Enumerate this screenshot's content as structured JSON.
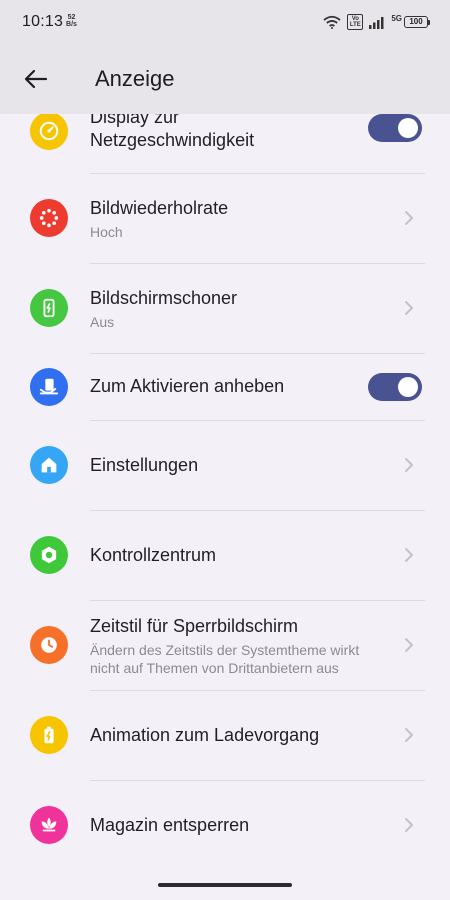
{
  "status_bar": {
    "time": "10:13",
    "net_speed_value": "52",
    "net_speed_unit": "B/s",
    "volte_top": "Vo",
    "volte_bottom": "LTE",
    "network": "5G",
    "battery": "100"
  },
  "header": {
    "title": "Anzeige"
  },
  "settings": [
    {
      "title_line1": "Display zur",
      "title_line2": "Netzgeschwindigkeit",
      "toggle": "on",
      "icon": "speedometer-icon",
      "color": "#f7c400"
    },
    {
      "title": "Bildwiederholrate",
      "subtitle": "Hoch",
      "icon": "refresh-rate-icon",
      "color": "#ee3b2f"
    },
    {
      "title": "Bildschirmschoner",
      "subtitle": "Aus",
      "icon": "screensaver-icon",
      "color": "#45c742"
    },
    {
      "title": "Zum Aktivieren anheben",
      "toggle": "on",
      "icon": "raise-hand-phone-icon",
      "color": "#2f6ff0"
    },
    {
      "title": "Einstellungen",
      "icon": "home-icon",
      "color": "#35a6f5"
    },
    {
      "title": "Kontrollzentrum",
      "icon": "control-center-icon",
      "color": "#3fc93a"
    },
    {
      "title": "Zeitstil für Sperrbildschirm",
      "subtitle_line1": "Ändern des Zeitstils der Systemtheme wirkt",
      "subtitle_line2": "nicht auf Themen von Drittanbietern aus",
      "icon": "clock-icon",
      "color": "#f7702a"
    },
    {
      "title": "Animation zum Ladevorgang",
      "icon": "battery-charging-icon",
      "color": "#f7c400"
    },
    {
      "title": "Magazin entsperren",
      "icon": "lotus-icon",
      "color": "#f0339a"
    }
  ],
  "colors": {
    "background": "#f3f1f7",
    "header_background": "#e7e5ea",
    "toggle_on": "#4a5391"
  }
}
